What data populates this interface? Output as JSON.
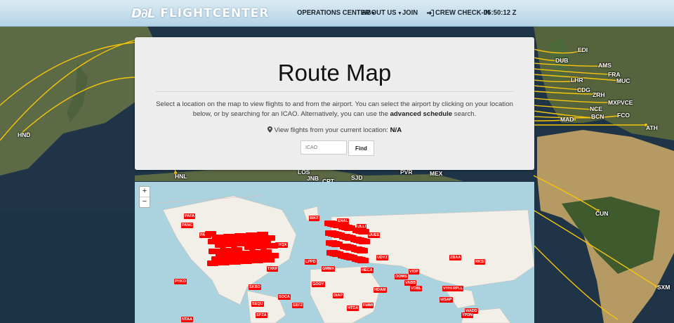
{
  "nav": {
    "logo_mark": "D∂L",
    "logo_text": "FLIGHTCENTER",
    "items": [
      {
        "label": "OPERATIONS CENTER",
        "caret": "▾"
      },
      {
        "label": "ABOUT US",
        "caret": "▾"
      },
      {
        "label": "JOIN"
      },
      {
        "label": "CREW CHECK-IN",
        "icon": "sign-in-icon"
      },
      {
        "label": "05:50:12 Z"
      }
    ]
  },
  "card": {
    "title": "Route Map",
    "desc_1": "Select a location on the map to view flights to and from the airport. You can select the airport by clicking on your location below, or by searching for an ICAO. Alternatively, you can use the ",
    "desc_link": "advanced schedule",
    "desc_2": " search.",
    "curloc_label": "View flights from your current location:",
    "curloc_value": "N/A",
    "icao_placeholder": "ICAO",
    "find_label": "Find"
  },
  "map_controls": {
    "zoom_in": "+",
    "zoom_out": "−"
  },
  "background_labels": [
    "EDI",
    "DUB",
    "AMS",
    "FRA",
    "MUC",
    "LHR",
    "CDG",
    "ZRH",
    "MXP",
    "VCE",
    "NCE",
    "BCN",
    "FCO",
    "MAD",
    "ATH",
    "HND",
    "HNL",
    "LOS",
    "JNB",
    "CPT",
    "SJD",
    "PVR",
    "MEX",
    "CUN",
    "SXM"
  ],
  "pins": [
    "PAFA",
    "PANC",
    "PAKT",
    "CYQX",
    "BIKF",
    "ENAL",
    "ULLI",
    "UUEE",
    "UDYZ",
    "ZBAA",
    "RKSI",
    "VIDP",
    "LPPD",
    "GMMX",
    "HECA",
    "OOMS",
    "VABB",
    "VOBL",
    "VHHH",
    "RPLL",
    "WSAP",
    "WADD",
    "YPDN",
    "TXKF",
    "PHKO",
    "SKBO",
    "SBFZ",
    "GOOY",
    "DIAP",
    "HDAM",
    "FMMI",
    "HTDA",
    "SEQU",
    "SPZA",
    "NTAA",
    "SOCA"
  ],
  "colors": {
    "route": "#f6c40a",
    "pin": "#ff0000",
    "nav": "#c4deed",
    "card": "#ededed"
  }
}
